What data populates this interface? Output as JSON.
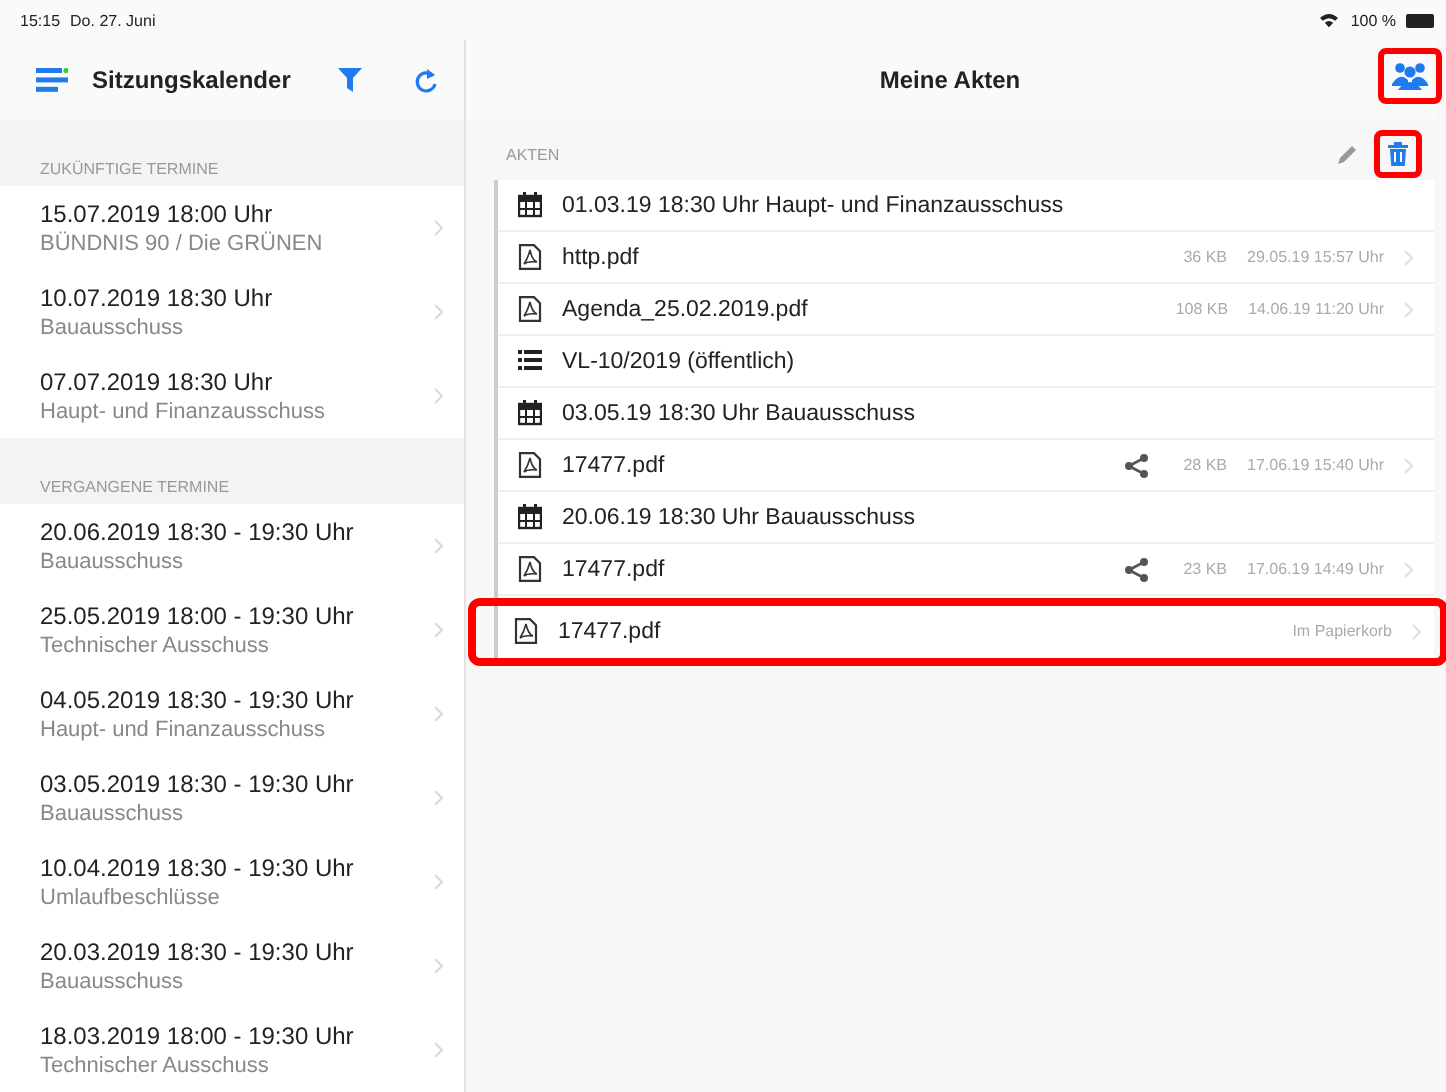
{
  "status_bar": {
    "time": "15:15",
    "date": "Do. 27. Juni",
    "battery": "100 %"
  },
  "sidebar": {
    "title": "Sitzungskalender",
    "sections": [
      {
        "label": "ZUKÜNFTIGE TERMINE",
        "items": [
          {
            "date": "15.07.2019 18:00 Uhr",
            "title": "BÜNDNIS 90 / Die GRÜNEN"
          },
          {
            "date": "10.07.2019 18:30 Uhr",
            "title": "Bauausschuss"
          },
          {
            "date": "07.07.2019 18:30 Uhr",
            "title": "Haupt- und Finanzausschuss"
          }
        ]
      },
      {
        "label": "VERGANGENE TERMINE",
        "items": [
          {
            "date": "20.06.2019 18:30 -  19:30 Uhr",
            "title": "Bauausschuss"
          },
          {
            "date": "25.05.2019 18:00 -  19:30 Uhr",
            "title": "Technischer Ausschuss"
          },
          {
            "date": "04.05.2019 18:30 -  19:30 Uhr",
            "title": "Haupt- und Finanzausschuss"
          },
          {
            "date": "03.05.2019 18:30 -  19:30 Uhr",
            "title": "Bauausschuss"
          },
          {
            "date": "10.04.2019 18:30 -  19:30 Uhr",
            "title": "Umlaufbeschlüsse"
          },
          {
            "date": "20.03.2019 18:30 -  19:30 Uhr",
            "title": "Bauausschuss"
          },
          {
            "date": "18.03.2019 18:00 -  19:30 Uhr",
            "title": "Technischer Ausschuss"
          }
        ]
      }
    ]
  },
  "main": {
    "title": "Meine Akten",
    "section_label": "AKTEN",
    "rows": [
      {
        "kind": "meeting",
        "label": "01.03.19 18:30 Uhr  Haupt- und Finanzausschuss",
        "highlighted": false
      },
      {
        "kind": "file",
        "label": "http.pdf",
        "size": "36 KB",
        "modified": "29.05.19 15:57 Uhr",
        "shared": false,
        "highlighted": false
      },
      {
        "kind": "file",
        "label": "Agenda_25.02.2019.pdf",
        "size": "108 KB",
        "modified": "14.06.19 11:20 Uhr",
        "shared": false,
        "highlighted": false
      },
      {
        "kind": "agenda",
        "label": "VL-10/2019 (öffentlich)",
        "highlighted": false
      },
      {
        "kind": "meeting",
        "label": "03.05.19 18:30 Uhr  Bauausschuss",
        "highlighted": false
      },
      {
        "kind": "file",
        "label": "17477.pdf",
        "size": "28 KB",
        "modified": "17.06.19 15:40 Uhr",
        "shared": true,
        "highlighted": false
      },
      {
        "kind": "meeting",
        "label": "20.06.19 18:30 Uhr  Bauausschuss",
        "highlighted": false
      },
      {
        "kind": "file",
        "label": "17477.pdf",
        "size": "23 KB",
        "modified": "17.06.19 14:49 Uhr",
        "shared": true,
        "highlighted": false
      },
      {
        "kind": "file",
        "label": "17477.pdf",
        "modified": "Im Papierkorb",
        "shared": false,
        "highlighted": true
      }
    ]
  }
}
